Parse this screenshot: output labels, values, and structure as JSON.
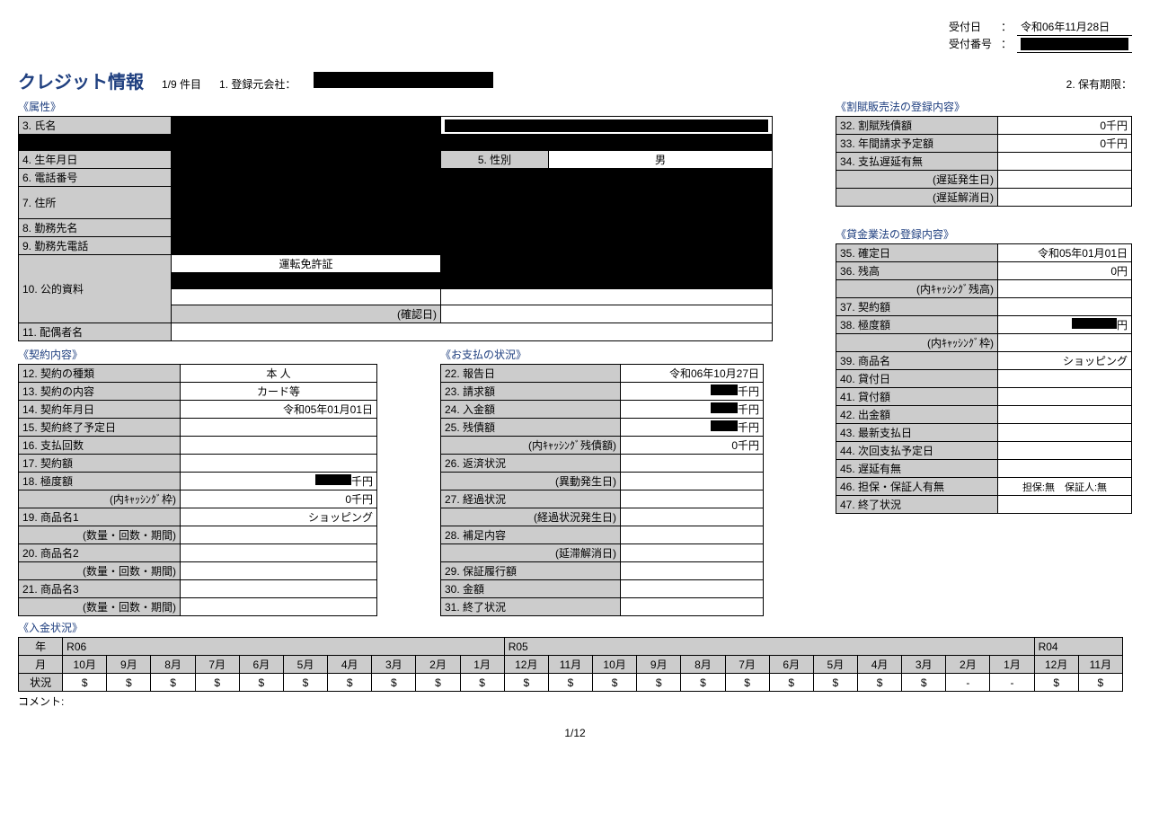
{
  "header": {
    "title": "クレジット情報",
    "count": "1/9 件目",
    "label_reg_company": "1. 登録元会社：",
    "label_retention": "2. 保有期限：",
    "receipt_date_label": "受付日",
    "receipt_date_value": "令和06年11月28日",
    "receipt_no_label": "受付番号",
    "colon": "："
  },
  "attr": {
    "section": "《属性》",
    "r3": "3. 氏名",
    "r4": "4. 生年月日",
    "r5": "5. 性別",
    "r5v": "男",
    "r6": "6. 電話番号",
    "r7": "7. 住所",
    "r8": "8. 勤務先名",
    "r9": "9. 勤務先電話",
    "r10": "10. 公的資料",
    "r10a": "運転免許証",
    "r10c": "(確認日)",
    "r11": "11. 配偶者名"
  },
  "contract": {
    "section": "《契約内容》",
    "r12": "12. 契約の種類",
    "v12": "本 人",
    "r13": "13. 契約の内容",
    "v13": "カード等",
    "r14": "14. 契約年月日",
    "v14": "令和05年01月01日",
    "r15": "15. 契約終了予定日",
    "r16": "16. 支払回数",
    "r17": "17. 契約額",
    "r18": "18. 極度額",
    "v18suffix": "千円",
    "r18b": "(内ｷｬｯｼﾝｸﾞ枠)",
    "v18b": "0千円",
    "r19": "19. 商品名1",
    "v19": "ショッピング",
    "r19b": "(数量・回数・期間)",
    "r20": "20. 商品名2",
    "r20b": "(数量・回数・期間)",
    "r21": "21. 商品名3",
    "r21b": "(数量・回数・期間)"
  },
  "payment": {
    "section": "《お支払の状況》",
    "r22": "22. 報告日",
    "v22": "令和06年10月27日",
    "r23": "23. 請求額",
    "v23suffix": "千円",
    "r24": "24. 入金額",
    "v24suffix": "千円",
    "r25": "25. 残債額",
    "v25suffix": "千円",
    "r25b": "(内ｷｬｯｼﾝｸﾞ残債額)",
    "v25b": "0千円",
    "r26": "26. 返済状況",
    "r26b": "(異動発生日)",
    "r27": "27. 経過状況",
    "r27b": "(経過状況発生日)",
    "r28": "28. 補足内容",
    "r28b": "(延滞解消日)",
    "r29": "29. 保証履行額",
    "r30": "30. 金額",
    "r31": "31. 終了状況"
  },
  "installment": {
    "section": "《割賦販売法の登録内容》",
    "r32": "32. 割賦残債額",
    "v32": "0千円",
    "r33": "33. 年間請求予定額",
    "v33": "0千円",
    "r34": "34. 支払遅延有無",
    "r34b": "(遅延発生日)",
    "r34c": "(遅延解消日)"
  },
  "moneylending": {
    "section": "《貸金業法の登録内容》",
    "r35": "35. 確定日",
    "v35": "令和05年01月01日",
    "r36": "36. 残高",
    "v36": "0円",
    "r36b": "(内ｷｬｯｼﾝｸﾞ残高)",
    "r37": "37. 契約額",
    "r38": "38. 極度額",
    "v38suffix": "円",
    "r38b": "(内ｷｬｯｼﾝｸﾞ枠)",
    "r39": "39. 商品名",
    "v39": "ショッピング",
    "r40": "40. 貸付日",
    "r41": "41. 貸付額",
    "r42": "42. 出金額",
    "r43": "43. 最新支払日",
    "r44": "44. 次回支払予定日",
    "r45": "45. 遅延有無",
    "r46": "46. 担保・保証人有無",
    "v46": "担保:無　保証人:無",
    "r47": "47. 終了状況"
  },
  "deposit": {
    "section": "《入金状況》",
    "year_label": "年",
    "month_label": "月",
    "status_label": "状況",
    "years": [
      "R06",
      "R05",
      "R04"
    ],
    "months": [
      "10月",
      "9月",
      "8月",
      "7月",
      "6月",
      "5月",
      "4月",
      "3月",
      "2月",
      "1月",
      "12月",
      "11月",
      "10月",
      "9月",
      "8月",
      "7月",
      "6月",
      "5月",
      "4月",
      "3月",
      "2月",
      "1月",
      "12月",
      "11月"
    ],
    "status": [
      "$",
      "$",
      "$",
      "$",
      "$",
      "$",
      "$",
      "$",
      "$",
      "$",
      "$",
      "$",
      "$",
      "$",
      "$",
      "$",
      "$",
      "$",
      "$",
      "$",
      "-",
      "-",
      "$",
      "$"
    ],
    "comment_label": "コメント:"
  },
  "footer": {
    "page": "1/12"
  }
}
